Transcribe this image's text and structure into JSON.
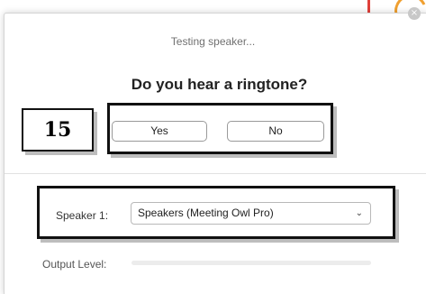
{
  "dialog": {
    "status_text": "Testing speaker...",
    "question": "Do you hear a ringtone?",
    "yes_label": "Yes",
    "no_label": "No",
    "close_glyph": "×"
  },
  "annotation": {
    "step_number": "15"
  },
  "speaker": {
    "label": "Speaker 1:",
    "selected": "Speakers (Meeting Owl Pro)",
    "chevron_glyph": "⌄"
  },
  "output_level": {
    "label": "Output Level:",
    "value": 0
  },
  "colors": {
    "accent": "#2d8cff",
    "annotation_border": "#111111"
  }
}
